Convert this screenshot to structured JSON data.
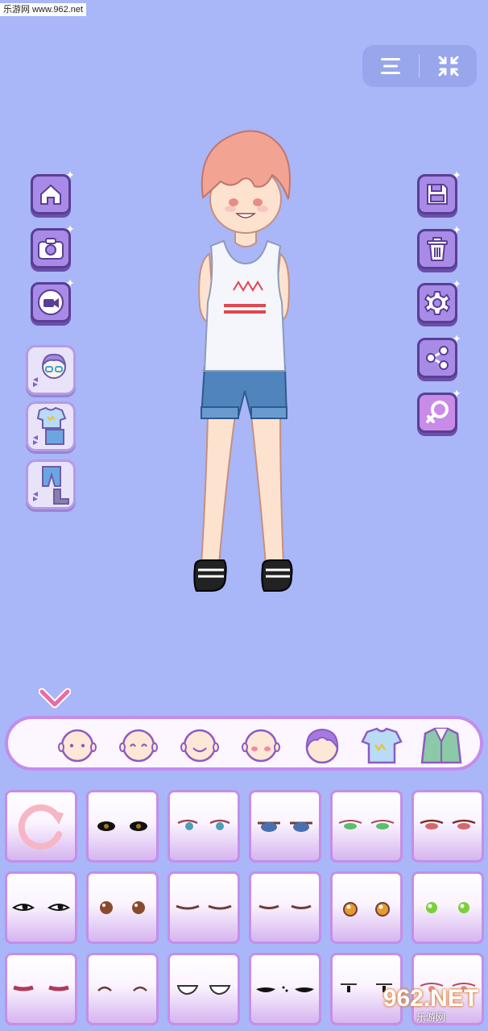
{
  "watermark": {
    "top_text": "乐游网 www.962.net",
    "bottom_big": "962.NET",
    "bottom_small": "乐游网"
  },
  "top_controls": {
    "menu_icon": "hamburger-icon",
    "fullscreen_icon": "collapse-arrows-icon"
  },
  "left_buttons": [
    "home-icon",
    "camera-icon",
    "video-camera-icon"
  ],
  "category_buttons": [
    "change-head-icon",
    "change-outfit-icon",
    "change-pants-shoes-icon"
  ],
  "right_buttons": [
    "save-icon",
    "trash-icon",
    "settings-icon",
    "share-icon",
    "gender-female-icon"
  ],
  "tabs": [
    "face-shape-tab",
    "eyes-smile-tab",
    "mouth-tab",
    "blush-tab",
    "hair-tab",
    "shirt-tab",
    "jacket-tab"
  ],
  "selected_tab": "hair-tab",
  "colors": {
    "background": "#a9b6f8",
    "button_fill": "#a88be6",
    "button_border": "#5a3e95",
    "tile_border": "#c58ee9",
    "tab_bar_border": "#c48cec"
  },
  "eye_options": {
    "row1": [
      "reset",
      "black-almond",
      "teal-lashes",
      "blue-sleepy",
      "green-lashes",
      "red-lashes"
    ],
    "row2": [
      "simple-dot",
      "brown-round",
      "closed-lashes",
      "closed-lashes-2",
      "orange-sparkle",
      "green-sparkle"
    ],
    "row3": [
      "red-lashes-closed",
      "curved-closed",
      "white-half",
      "dark-squint",
      "black-small",
      "pink-sleepy"
    ]
  }
}
